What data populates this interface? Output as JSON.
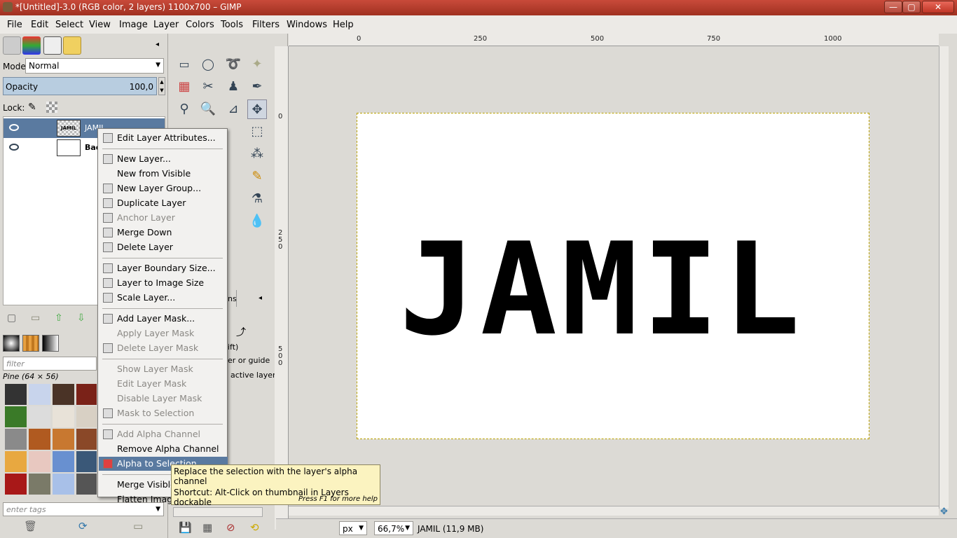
{
  "window": {
    "title": "*[Untitled]-3.0 (RGB color, 2 layers) 1100x700 – GIMP",
    "minimize": "—",
    "maximize": "▢",
    "close": "✕"
  },
  "menubar": [
    "File",
    "Edit",
    "Select",
    "View",
    "Image",
    "Layer",
    "Colors",
    "Tools",
    "Filters",
    "Windows",
    "Help"
  ],
  "layers_panel": {
    "mode_label": "Mode:",
    "mode_value": "Normal",
    "opacity_label": "Opacity",
    "opacity_value": "100,0",
    "lock_label": "Lock:",
    "layers": [
      {
        "name": "JAMIL",
        "thumb_text": "JAMIL",
        "selected": true
      },
      {
        "name": "Bac",
        "thumb_text": "",
        "selected": false
      }
    ]
  },
  "patterns_panel": {
    "filter_placeholder": "filter",
    "pattern_name": "Pine (64 × 56)",
    "tags_placeholder": "enter tags"
  },
  "toolbox": {
    "options_tab_fragment": "ns",
    "option_lines": [
      "ift)",
      "er or guide",
      "active layer"
    ]
  },
  "rulers": {
    "h_labels": [
      "0",
      "250",
      "500",
      "750",
      "1000"
    ],
    "v_labels": [
      "0",
      "250",
      "500"
    ]
  },
  "canvas": {
    "text": "JAMIL"
  },
  "statusbar": {
    "unit": "px",
    "zoom": "66,7%",
    "info": "JAMIL (11,9 MB)"
  },
  "context_menu": {
    "items": [
      {
        "label": "Edit Layer Attributes...",
        "disabled": false,
        "icon": "edit-icon"
      },
      {
        "sep": true
      },
      {
        "label": "New Layer...",
        "disabled": false,
        "icon": "new-layer-icon"
      },
      {
        "label": "New from Visible",
        "disabled": false,
        "icon": ""
      },
      {
        "label": "New Layer Group...",
        "disabled": false,
        "icon": "folder-icon"
      },
      {
        "label": "Duplicate Layer",
        "disabled": false,
        "icon": "duplicate-icon"
      },
      {
        "label": "Anchor Layer",
        "disabled": true,
        "icon": "anchor-icon"
      },
      {
        "label": "Merge Down",
        "disabled": false,
        "icon": "merge-icon"
      },
      {
        "label": "Delete Layer",
        "disabled": false,
        "icon": "trash-icon"
      },
      {
        "sep": true
      },
      {
        "label": "Layer Boundary Size...",
        "disabled": false,
        "icon": "boundary-icon"
      },
      {
        "label": "Layer to Image Size",
        "disabled": false,
        "icon": "fit-icon"
      },
      {
        "label": "Scale Layer...",
        "disabled": false,
        "icon": "scale-icon"
      },
      {
        "sep": true
      },
      {
        "label": "Add Layer Mask...",
        "disabled": false,
        "icon": "mask-icon"
      },
      {
        "label": "Apply Layer Mask",
        "disabled": true,
        "icon": ""
      },
      {
        "label": "Delete Layer Mask",
        "disabled": true,
        "icon": "trash-icon"
      },
      {
        "sep": true
      },
      {
        "label": "Show Layer Mask",
        "disabled": true,
        "icon": ""
      },
      {
        "label": "Edit Layer Mask",
        "disabled": true,
        "icon": ""
      },
      {
        "label": "Disable Layer Mask",
        "disabled": true,
        "icon": ""
      },
      {
        "label": "Mask to Selection",
        "disabled": true,
        "icon": "mask-selection-icon"
      },
      {
        "sep": true
      },
      {
        "label": "Add Alpha Channel",
        "disabled": true,
        "icon": "alpha-icon"
      },
      {
        "label": "Remove Alpha Channel",
        "disabled": false,
        "icon": ""
      },
      {
        "label": "Alpha to Selection",
        "disabled": false,
        "icon": "alpha-selection-icon",
        "active": true
      },
      {
        "sep": true
      },
      {
        "label": "Merge Visible",
        "disabled": false,
        "icon": ""
      },
      {
        "label": "Flatten Image",
        "disabled": false,
        "icon": ""
      }
    ]
  },
  "tooltip": {
    "line1": "Replace the selection with the layer's alpha channel",
    "line2": "Shortcut: Alt-Click on thumbnail in Layers dockable",
    "hint": "Press F1 for more help"
  },
  "colors": {
    "titlebar": "#b03b2b",
    "menu_highlight": "#5a7aa0",
    "selection_outline": "#b8a000"
  }
}
